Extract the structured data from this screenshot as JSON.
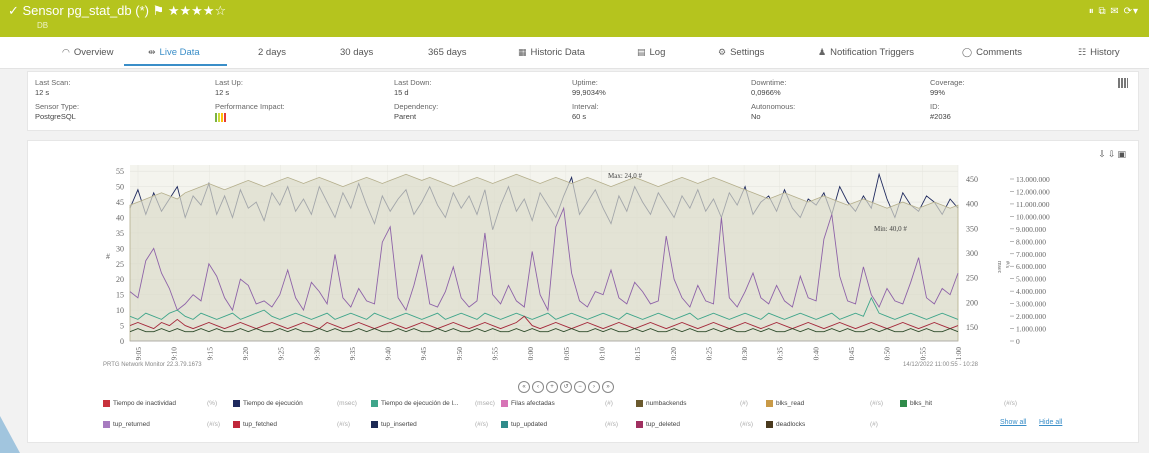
{
  "header": {
    "title": "✓ Sensor pg_stat_db (*) ⚑ ★★★★☆",
    "subtitle": "DB",
    "right_icons": "⏸ ⧉ ✉ ⟳▾"
  },
  "tabs": [
    {
      "icon": "◠",
      "label": "Overview"
    },
    {
      "icon": "⇹",
      "label": "Live Data"
    },
    {
      "icon": "",
      "label": "2  days"
    },
    {
      "icon": "",
      "label": "30 days"
    },
    {
      "icon": "",
      "label": "365 days"
    },
    {
      "icon": "▦",
      "label": "Historic Data"
    },
    {
      "icon": "▤",
      "label": "Log"
    },
    {
      "icon": "⚙",
      "label": "Settings"
    },
    {
      "icon": "♟",
      "label": "Notification Triggers"
    },
    {
      "icon": "◯",
      "label": "Comments"
    },
    {
      "icon": "☷",
      "label": "History"
    }
  ],
  "info": {
    "last_scan_label": "Last Scan:",
    "last_scan": "12 s",
    "last_up_label": "Last Up:",
    "last_up": "12 s",
    "last_down_label": "Last Down:",
    "last_down": "15 d",
    "uptime_label": "Uptime:",
    "uptime": "99,9034%",
    "downtime_label": "Downtime:",
    "downtime": "0,0966%",
    "coverage_label": "Coverage:",
    "coverage": "99%",
    "sensor_type_label": "Sensor Type:",
    "sensor_type": "PostgreSQL",
    "perf_label": "Performance Impact:",
    "dependency_label": "Dependency:",
    "dependency": "Parent",
    "interval_label": "Interval:",
    "interval": "60 s",
    "autonomous_label": "Autonomous:",
    "autonomous": "No",
    "id_label": "ID:",
    "id": "#2036"
  },
  "chart_data": {
    "type": "line",
    "x": [
      "9:05",
      "9:10",
      "9:15",
      "9:20",
      "9:25",
      "9:30",
      "9:35",
      "9:40",
      "9:45",
      "9:50",
      "9:55",
      "10:00",
      "10:05",
      "10:10",
      "10:15",
      "10:20",
      "10:25",
      "10:30",
      "10:35",
      "10:40",
      "10:45",
      "10:50",
      "10:55",
      "11:00"
    ],
    "left_ticks": [
      "0",
      "5",
      "10",
      "15",
      "20",
      "25",
      "30",
      "35",
      "40",
      "45",
      "50",
      "55"
    ],
    "left_axis_label": "#",
    "mid_ticks": [
      "150",
      "200",
      "250",
      "300",
      "350",
      "400",
      "450"
    ],
    "mid_axis_label": "msec",
    "right_ticks": [
      "0",
      "1.000.000",
      "2.000.000",
      "3.000.000",
      "4.000.000",
      "5.000.000",
      "6.000.000",
      "7.000.000",
      "8.000.000",
      "9.000.000",
      "10.000.000",
      "11.000.000",
      "12.000.000",
      "13.000.000"
    ],
    "right_axis_label": "#/s",
    "annot_max": "Max: 24,0 #",
    "annot_min": "Min: 40,0 #",
    "ylim_left": [
      0,
      57
    ],
    "series": [
      {
        "name": "Tiempo de ejecución",
        "color": "#1f2a5e",
        "values": [
          43,
          49,
          41,
          48,
          42,
          46,
          50,
          40,
          47,
          44,
          51,
          41,
          47,
          40,
          49,
          43,
          45,
          39,
          48,
          44,
          50,
          42,
          46,
          41,
          50,
          45,
          40,
          48,
          43,
          51,
          44,
          38,
          47,
          42,
          46,
          49,
          41,
          45,
          50,
          44,
          40,
          48,
          43,
          47,
          41,
          49,
          36,
          44,
          50,
          42,
          46,
          39,
          48,
          44,
          40,
          47,
          53,
          41,
          45,
          49,
          43,
          38,
          47,
          42,
          50,
          45,
          41,
          48,
          44,
          40,
          47,
          43,
          49,
          42,
          46,
          40,
          48,
          44,
          50,
          41,
          45,
          47,
          42,
          49,
          43,
          40,
          46,
          44,
          48,
          41,
          50,
          45,
          42,
          47,
          43,
          54,
          46,
          40,
          48,
          44,
          42,
          47,
          45,
          41,
          46,
          43
        ]
      },
      {
        "name": "Tiempo de ejecución de l...",
        "color": "#b4ae8b",
        "fill": true,
        "values": [
          44,
          45,
          46,
          47,
          48,
          47,
          46,
          48,
          49,
          50,
          51,
          50,
          49,
          50,
          51,
          52,
          51,
          50,
          51,
          52,
          53,
          52,
          51,
          52,
          53,
          52,
          51,
          50,
          51,
          52,
          53,
          52,
          51,
          52,
          53,
          54,
          53,
          52,
          53,
          52,
          51,
          50,
          51,
          52,
          53,
          52,
          51,
          52,
          53,
          54,
          53,
          52,
          51,
          52,
          53,
          52,
          51,
          52,
          53,
          52,
          51,
          50,
          51,
          52,
          53,
          52,
          51,
          50,
          51,
          52,
          53,
          52,
          51,
          52,
          53,
          52,
          51,
          50,
          49,
          48,
          47,
          46,
          47,
          48,
          47,
          46,
          45,
          46,
          47,
          46,
          45,
          44,
          45,
          46,
          45,
          44,
          43,
          44,
          45,
          44,
          43,
          44,
          45,
          44,
          43,
          44
        ]
      },
      {
        "name": "tup_returned",
        "color": "#8e63a8",
        "values": [
          16,
          14,
          26,
          30,
          22,
          17,
          10,
          12,
          15,
          13,
          25,
          21,
          14,
          10,
          20,
          18,
          12,
          13,
          11,
          15,
          23,
          14,
          10,
          19,
          16,
          12,
          28,
          14,
          11,
          17,
          13,
          12,
          32,
          37,
          14,
          10,
          18,
          28,
          12,
          11,
          16,
          24,
          14,
          11,
          13,
          35,
          15,
          12,
          18,
          13,
          11,
          29,
          15,
          10,
          37,
          43,
          22,
          13,
          11,
          16,
          15,
          23,
          14,
          12,
          19,
          16,
          12,
          13,
          34,
          20,
          14,
          11,
          18,
          13,
          12,
          40,
          14,
          11,
          16,
          22,
          14,
          12,
          18,
          13,
          11,
          21,
          14,
          13,
          33,
          41,
          21,
          13,
          12,
          24,
          15,
          11,
          17,
          13,
          12,
          19,
          27,
          14,
          12,
          17,
          15,
          22
        ]
      },
      {
        "name": "numbackends",
        "color": "#3fa58a",
        "values": [
          8,
          7,
          9,
          8,
          7,
          9,
          10,
          8,
          7,
          9,
          8,
          7,
          8,
          9,
          7,
          8,
          9,
          10,
          8,
          7,
          8,
          9,
          8,
          7,
          8,
          9,
          7,
          8,
          9,
          8,
          7,
          9,
          8,
          7,
          8,
          9,
          8,
          7,
          8,
          9,
          7,
          8,
          9,
          8,
          7,
          9,
          8,
          7,
          8,
          9,
          8,
          7,
          8,
          9,
          7,
          8,
          9,
          8,
          7,
          8,
          9,
          8,
          7,
          9,
          8,
          7,
          8,
          9,
          8,
          7,
          8,
          9,
          7,
          8,
          9,
          8,
          7,
          8,
          9,
          8,
          7,
          9,
          8,
          7,
          8,
          9,
          8,
          7,
          8,
          9,
          7,
          8,
          9,
          8,
          14,
          9,
          8,
          7,
          8,
          9,
          8,
          7,
          8,
          9,
          8,
          7
        ]
      },
      {
        "name": "tup_deleted",
        "color": "#a52a3c",
        "values": [
          5,
          6,
          5,
          4,
          6,
          5,
          7,
          5,
          4,
          5,
          6,
          5,
          4,
          5,
          6,
          5,
          4,
          5,
          6,
          5,
          4,
          5,
          6,
          5,
          4,
          6,
          5,
          4,
          5,
          6,
          5,
          4,
          5,
          6,
          5,
          4,
          5,
          6,
          5,
          4,
          5,
          6,
          5,
          4,
          5,
          6,
          5,
          4,
          5,
          6,
          8,
          5,
          4,
          5,
          6,
          5,
          4,
          5,
          6,
          5,
          4,
          5,
          6,
          5,
          4,
          5,
          6,
          5,
          4,
          5,
          6,
          5,
          4,
          5,
          6,
          5,
          4,
          5,
          6,
          5,
          4,
          5,
          6,
          5,
          4,
          5,
          6,
          5,
          4,
          5,
          6,
          5,
          4,
          5,
          6,
          5,
          4,
          5,
          6,
          5,
          4,
          5,
          6,
          5,
          4,
          5
        ]
      },
      {
        "name": "deadlocks",
        "color": "#2d4a2a",
        "values": [
          3,
          4,
          3,
          3,
          4,
          3,
          4,
          3,
          3,
          4,
          3,
          4,
          3,
          3,
          4,
          3,
          4,
          3,
          3,
          4,
          3,
          4,
          3,
          3,
          4,
          3,
          4,
          3,
          3,
          4,
          3,
          4,
          3,
          3,
          4,
          3,
          4,
          3,
          3,
          4,
          3,
          4,
          3,
          3,
          4,
          3,
          4,
          3,
          3,
          4,
          3,
          4,
          3,
          3,
          4,
          3,
          4,
          3,
          3,
          4,
          3,
          4,
          3,
          3,
          4,
          3,
          4,
          3,
          3,
          4,
          3,
          4,
          3,
          3,
          4,
          3,
          4,
          3,
          3,
          4,
          3,
          4,
          3,
          3,
          4,
          3,
          4,
          3,
          3,
          4,
          3,
          4,
          3,
          3,
          4,
          3,
          4,
          3,
          3,
          4,
          3,
          4,
          3,
          3,
          4,
          3
        ]
      }
    ]
  },
  "footer_left": "PRTG Network Monitor 22.3.79.1673",
  "footer_right": "14/12/2022 11:00:55 - 10:28",
  "nav_buttons": [
    "«",
    "‹",
    "+",
    "↺",
    "−",
    "›",
    "»"
  ],
  "legend": [
    {
      "name": "Tiempo de inactividad",
      "unit": "(%)",
      "color": "#c8323c"
    },
    {
      "name": "Tiempo de ejecución",
      "unit": "(msec)",
      "color": "#1f2a5e"
    },
    {
      "name": "Tiempo de ejecución de l...",
      "unit": "(msec)",
      "color": "#3fa58a"
    },
    {
      "name": "Filas afectadas",
      "unit": "(#)",
      "color": "#d774b6"
    },
    {
      "name": "numbackends",
      "unit": "(#)",
      "color": "#6b5a2e"
    },
    {
      "name": "blks_read",
      "unit": "(#/s)",
      "color": "#c99a47"
    },
    {
      "name": "blks_hit",
      "unit": "(#/s)",
      "color": "#2f8b4a"
    },
    {
      "name": "tup_returned",
      "unit": "(#/s)",
      "color": "#a77bc0"
    },
    {
      "name": "tup_fetched",
      "unit": "(#/s)",
      "color": "#c0273a"
    },
    {
      "name": "tup_inserted",
      "unit": "(#/s)",
      "color": "#1d2a55"
    },
    {
      "name": "tup_updated",
      "unit": "(#/s)",
      "color": "#2f8b8a"
    },
    {
      "name": "tup_deleted",
      "unit": "(#/s)",
      "color": "#a03060"
    },
    {
      "name": "deadlocks",
      "unit": "(#)",
      "color": "#4a3a1e"
    }
  ],
  "show_all": "Show all",
  "hide_all": "Hide all"
}
